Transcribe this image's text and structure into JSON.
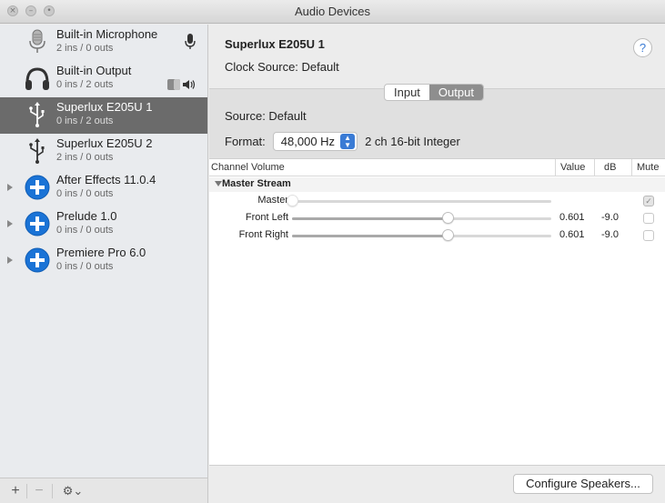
{
  "window": {
    "title": "Audio Devices"
  },
  "sidebar": {
    "devices": [
      {
        "name": "Built-in Microphone",
        "sub": "2 ins / 0 outs",
        "icon": "microphone-icon",
        "selected": false,
        "expandable": false
      },
      {
        "name": "Built-in Output",
        "sub": "0 ins / 2 outs",
        "icon": "headphones-icon",
        "selected": false,
        "expandable": false
      },
      {
        "name": "Superlux E205U 1",
        "sub": "0 ins / 2 outs",
        "icon": "usb-icon",
        "selected": true,
        "expandable": false
      },
      {
        "name": "Superlux E205U 2",
        "sub": "2 ins / 0 outs",
        "icon": "usb-icon",
        "selected": false,
        "expandable": false
      },
      {
        "name": "After Effects 11.0.4",
        "sub": "0 ins / 0 outs",
        "icon": "plus-circle-icon",
        "selected": false,
        "expandable": true
      },
      {
        "name": "Prelude 1.0",
        "sub": "0 ins / 0 outs",
        "icon": "plus-circle-icon",
        "selected": false,
        "expandable": true
      },
      {
        "name": "Premiere Pro 6.0",
        "sub": "0 ins / 0 outs",
        "icon": "plus-circle-icon",
        "selected": false,
        "expandable": true
      }
    ]
  },
  "toolbar": {
    "add_label": "+",
    "remove_label": "−",
    "gear_label": "⚙︎⌄"
  },
  "detail": {
    "device_name": "Superlux E205U 1",
    "clock_source": "Clock Source:  Default",
    "help_label": "?",
    "tabs": [
      {
        "label": "Input",
        "active": false
      },
      {
        "label": "Output",
        "active": true
      }
    ],
    "source": "Source:  Default",
    "format_label": "Format:",
    "format_value": "48,000 Hz",
    "format_desc": "2 ch 16-bit Integer"
  },
  "table": {
    "headers": {
      "channel": "Channel Volume",
      "value": "Value",
      "db": "dB",
      "mute": "Mute"
    },
    "group": "Master Stream",
    "rows": [
      {
        "label": "Master",
        "value": "",
        "db": "",
        "level": 0,
        "muted": true,
        "disabled": true
      },
      {
        "label": "Front Left",
        "value": "0.601",
        "db": "-9.0",
        "level": 0.601,
        "muted": false,
        "disabled": false
      },
      {
        "label": "Front Right",
        "value": "0.601",
        "db": "-9.0",
        "level": 0.601,
        "muted": false,
        "disabled": false
      }
    ]
  },
  "footer": {
    "configure_label": "Configure Speakers..."
  },
  "colors": {
    "accent": "#3a7bd5",
    "selection": "#6b6b6b",
    "app_icon_blue": "#1a73d6"
  }
}
